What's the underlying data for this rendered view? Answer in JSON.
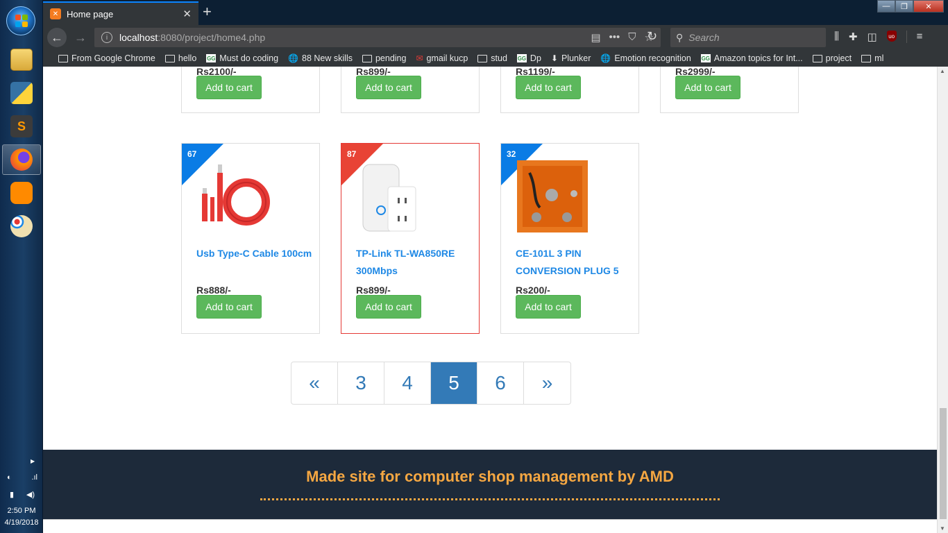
{
  "taskbar": {
    "time": "2:50 PM",
    "date": "4/19/2018",
    "apps": [
      "explorer",
      "python",
      "sublime-text",
      "firefox",
      "uc-browser",
      "paint"
    ]
  },
  "browser": {
    "tab_title": "Home page",
    "url_host": "localhost",
    "url_rest": ":8080/project/home4.php",
    "search_placeholder": "Search",
    "bookmarks": [
      {
        "label": "From Google Chrome",
        "icon": "folder-icon"
      },
      {
        "label": "hello",
        "icon": "folder-icon"
      },
      {
        "label": "Must do coding",
        "icon": "gfg-icon"
      },
      {
        "label": "88 New skills",
        "icon": "globe-icon"
      },
      {
        "label": "pending",
        "icon": "folder-icon"
      },
      {
        "label": "gmail kucp",
        "icon": "gmail-icon"
      },
      {
        "label": "stud",
        "icon": "folder-icon"
      },
      {
        "label": "Dp",
        "icon": "gfg-icon"
      },
      {
        "label": "Plunker",
        "icon": "plunker-icon"
      },
      {
        "label": "Emotion recognition",
        "icon": "globe-icon"
      },
      {
        "label": "Amazon topics for Int...",
        "icon": "gfg-icon"
      },
      {
        "label": "project",
        "icon": "folder-icon"
      },
      {
        "label": "ml",
        "icon": "folder-icon"
      }
    ]
  },
  "top_row": [
    {
      "price": "Rs2100/-",
      "button": "Add to cart"
    },
    {
      "price": "Rs899/-",
      "button": "Add to cart"
    },
    {
      "price": "Rs1199/-",
      "button": "Add to cart"
    },
    {
      "price": "Rs2999/-",
      "button": "Add to cart"
    }
  ],
  "products": [
    {
      "badge": "67",
      "badge_color": "#0a7ce5",
      "name": "Usb Type-C Cable 100cm",
      "price": "Rs888/-",
      "button": "Add to cart"
    },
    {
      "badge": "87",
      "badge_color": "#e84335",
      "name": "TP-Link TL-WA850RE 300Mbps",
      "price": "Rs899/-",
      "button": "Add to cart"
    },
    {
      "badge": "32",
      "badge_color": "#0a7ce5",
      "name": "CE-101L 3 PIN CONVERSION PLUG 5",
      "price": "Rs200/-",
      "button": "Add to cart"
    }
  ],
  "pagination": {
    "prev": "«",
    "pages": [
      "3",
      "4",
      "5",
      "6"
    ],
    "active": "5",
    "next": "»"
  },
  "footer": {
    "text": "Made site for computer shop management by AMD",
    "accent": "#f5a742"
  }
}
